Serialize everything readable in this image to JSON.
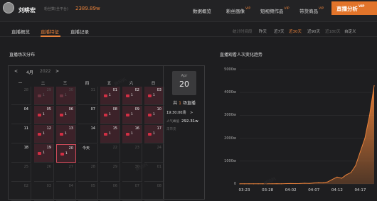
{
  "header": {
    "user_name": "刘畊宏",
    "fans_label": "粉丝数(全平台)",
    "fans_value": "2389.89w",
    "nav": [
      {
        "label": "数据概览",
        "vip": ""
      },
      {
        "label": "粉丝画像",
        "vip": "VIP"
      },
      {
        "label": "短视频作品",
        "vip": "VIP"
      },
      {
        "label": "带货商品",
        "vip": "VIP"
      }
    ],
    "nav_active": {
      "label": "直播分析",
      "vip": "VIP"
    }
  },
  "subnav": {
    "tabs": [
      "直播概览",
      "直播特征",
      "直播记录"
    ],
    "active_tab": "直播特征",
    "range_label": "统计时间段",
    "ranges": [
      "昨天",
      "近7天",
      "近30天",
      "近90天",
      "近180天",
      "自定义"
    ],
    "active_range": "近30天",
    "disabled_range": "近180天"
  },
  "calendar": {
    "title": "直播场次分布",
    "prev": "<",
    "next": ">",
    "month": "4月",
    "year": "2022",
    "weekdays": [
      "一",
      "二",
      "三",
      "四",
      "五",
      "六",
      "日"
    ],
    "weeks": [
      [
        {
          "d": "28",
          "c": "",
          "f": true,
          "l": false
        },
        {
          "d": "29",
          "c": "1",
          "f": true,
          "l": true
        },
        {
          "d": "30",
          "c": "1",
          "f": true,
          "l": true
        },
        {
          "d": "31",
          "c": "",
          "f": true,
          "l": false
        },
        {
          "d": "01",
          "c": "1",
          "f": false,
          "l": true
        },
        {
          "d": "02",
          "c": "1",
          "f": false,
          "l": true
        },
        {
          "d": "03",
          "c": "1",
          "f": false,
          "l": true
        }
      ],
      [
        {
          "d": "04",
          "c": "",
          "f": false,
          "l": false
        },
        {
          "d": "05",
          "c": "1",
          "f": false,
          "l": true
        },
        {
          "d": "06",
          "c": "1",
          "f": false,
          "l": true
        },
        {
          "d": "07",
          "c": "",
          "f": false,
          "l": false
        },
        {
          "d": "08",
          "c": "1",
          "f": false,
          "l": true
        },
        {
          "d": "09",
          "c": "1",
          "f": false,
          "l": true
        },
        {
          "d": "10",
          "c": "1",
          "f": false,
          "l": true
        }
      ],
      [
        {
          "d": "11",
          "c": "",
          "f": false,
          "l": false
        },
        {
          "d": "12",
          "c": "1",
          "f": false,
          "l": true
        },
        {
          "d": "13",
          "c": "1",
          "f": false,
          "l": true
        },
        {
          "d": "14",
          "c": "",
          "f": false,
          "l": false
        },
        {
          "d": "15",
          "c": "1",
          "f": false,
          "l": true
        },
        {
          "d": "16",
          "c": "1",
          "f": false,
          "l": true
        },
        {
          "d": "17",
          "c": "1",
          "f": false,
          "l": true
        }
      ],
      [
        {
          "d": "18",
          "c": "",
          "f": false,
          "l": false
        },
        {
          "d": "19",
          "c": "1",
          "f": false,
          "l": true
        },
        {
          "d": "20",
          "c": "1",
          "f": false,
          "l": true,
          "t": true
        },
        {
          "d": "今天",
          "c": "",
          "f": false,
          "l": false
        },
        {
          "d": "22",
          "c": "",
          "f": true,
          "l": false
        },
        {
          "d": "23",
          "c": "",
          "f": true,
          "l": false
        },
        {
          "d": "24",
          "c": "",
          "f": true,
          "l": false
        }
      ],
      [
        {
          "d": "25",
          "c": "",
          "f": true,
          "l": false
        },
        {
          "d": "26",
          "c": "",
          "f": true,
          "l": false
        },
        {
          "d": "27",
          "c": "",
          "f": true,
          "l": false
        },
        {
          "d": "28",
          "c": "",
          "f": true,
          "l": false
        },
        {
          "d": "29",
          "c": "",
          "f": true,
          "l": false
        },
        {
          "d": "30",
          "c": "",
          "f": true,
          "l": false
        },
        {
          "d": "01",
          "c": "",
          "f": true,
          "l": false
        }
      ],
      [
        {
          "d": "02",
          "c": "",
          "f": true,
          "l": false
        },
        {
          "d": "03",
          "c": "",
          "f": true,
          "l": false
        },
        {
          "d": "04",
          "c": "",
          "f": true,
          "l": false
        },
        {
          "d": "05",
          "c": "",
          "f": true,
          "l": false
        },
        {
          "d": "06",
          "c": "",
          "f": true,
          "l": false
        },
        {
          "d": "07",
          "c": "",
          "f": true,
          "l": false
        },
        {
          "d": "08",
          "c": "",
          "f": true,
          "l": false
        }
      ]
    ]
  },
  "day_panel": {
    "month": "Apr",
    "day": "20",
    "total_prefix": "共",
    "total_count": "1",
    "total_suffix": "场直播",
    "session_time": "19:30:00场",
    "session_arrow": ">",
    "peak_label": "人气峰值",
    "peak_value": "292.31w",
    "goods_label": "未带货"
  },
  "chart_data": {
    "type": "area",
    "title": "直播观看人次变化趋势",
    "yticks": [
      "5000w",
      "4000w",
      "3000w",
      "2000w",
      "1000w",
      "0"
    ],
    "ylim": [
      0,
      5000
    ],
    "xticks": [
      "03-23",
      "03-28",
      "04-02",
      "04-07",
      "04-12",
      "04-17"
    ],
    "x": [
      "03-22",
      "03-23",
      "03-24",
      "03-25",
      "03-26",
      "03-27",
      "03-28",
      "03-29",
      "03-30",
      "03-31",
      "04-01",
      "04-02",
      "04-03",
      "04-04",
      "04-05",
      "04-06",
      "04-07",
      "04-08",
      "04-09",
      "04-10",
      "04-11",
      "04-12",
      "04-13",
      "04-14",
      "04-15",
      "04-16",
      "04-17",
      "04-18",
      "04-19",
      "04-20"
    ],
    "values": [
      5,
      6,
      8,
      6,
      7,
      9,
      8,
      10,
      12,
      10,
      14,
      18,
      15,
      20,
      30,
      25,
      45,
      60,
      55,
      90,
      200,
      300,
      250,
      400,
      500,
      800,
      1400,
      2000,
      3000,
      4300
    ],
    "color": "#e8813a",
    "grid": true
  },
  "watermarks": [
    "蝉妈妈",
    "蝉妈妈",
    "蝉妈妈"
  ]
}
